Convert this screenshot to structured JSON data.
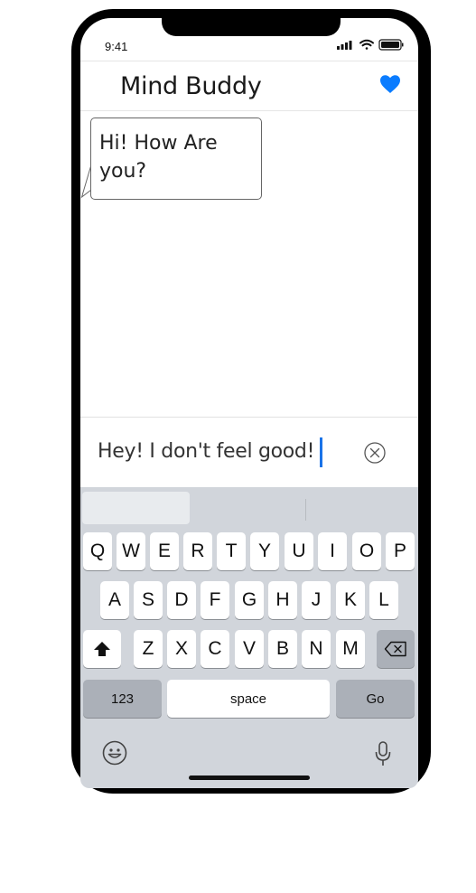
{
  "status": {
    "time": "9:41"
  },
  "header": {
    "title": "Mind Buddy"
  },
  "chat": {
    "messages": [
      {
        "text": "Hi! How Are you?"
      }
    ]
  },
  "input": {
    "value": "Hey! I don't feel good!"
  },
  "keyboard": {
    "row1": [
      "Q",
      "W",
      "E",
      "R",
      "T",
      "Y",
      "U",
      "I",
      "O",
      "P"
    ],
    "row2": [
      "A",
      "S",
      "D",
      "F",
      "G",
      "H",
      "J",
      "K",
      "L"
    ],
    "row3": [
      "Z",
      "X",
      "C",
      "V",
      "B",
      "N",
      "M"
    ],
    "numbers_label": "123",
    "space_label": "space",
    "go_label": "Go"
  },
  "colors": {
    "accent": "#1a73e8",
    "heart": "#0a7cff",
    "keyboard_bg": "#d1d5db"
  },
  "icons": [
    "signal-icon",
    "wifi-icon",
    "battery-icon",
    "heart-icon",
    "clear-icon",
    "shift-icon",
    "backspace-icon",
    "emoji-icon",
    "mic-icon"
  ]
}
